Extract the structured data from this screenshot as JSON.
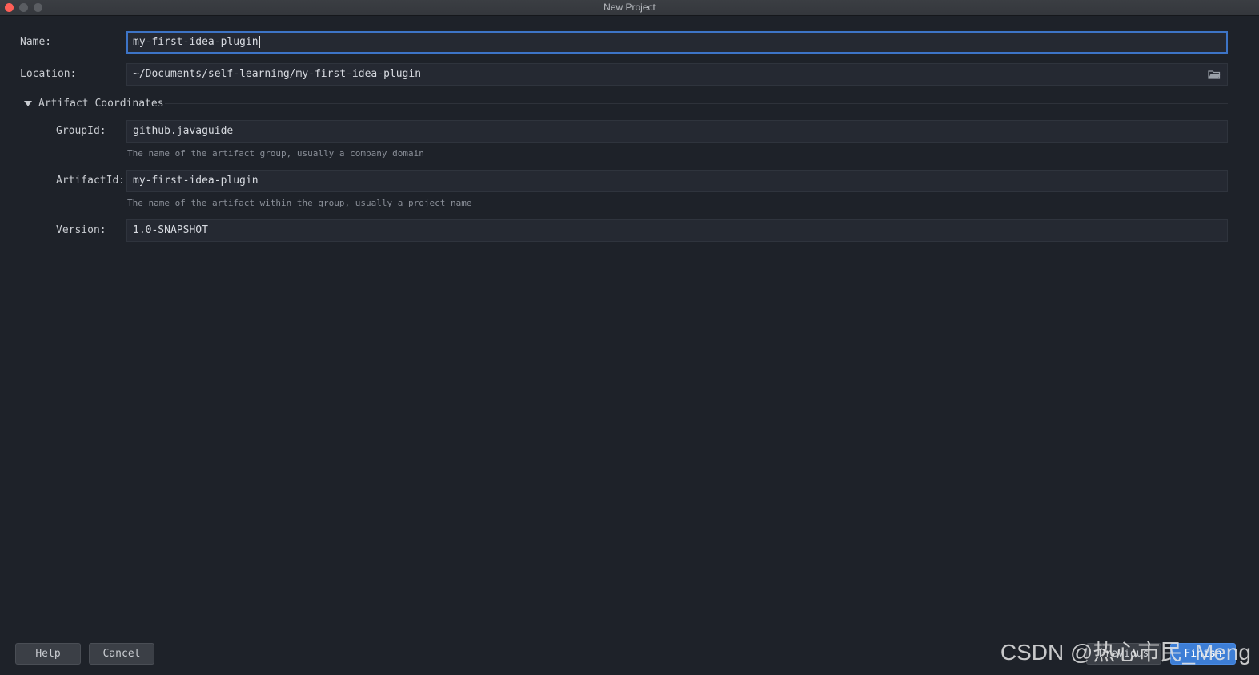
{
  "window": {
    "title": "New Project"
  },
  "form": {
    "name_label": "Name:",
    "name_value": "my-first-idea-plugin",
    "location_label": "Location:",
    "location_value": "~/Documents/self-learning/my-first-idea-plugin",
    "section_title": "Artifact Coordinates",
    "groupid_label": "GroupId:",
    "groupid_value": "github.javaguide",
    "groupid_hint": "The name of the artifact group, usually a company domain",
    "artifactid_label": "ArtifactId:",
    "artifactid_value": "my-first-idea-plugin",
    "artifactid_hint": "The name of the artifact within the group, usually a project name",
    "version_label": "Version:",
    "version_value": "1.0-SNAPSHOT"
  },
  "footer": {
    "help_label": "Help",
    "cancel_label": "Cancel",
    "previous_label": "Previous",
    "finish_label": "Finish"
  },
  "watermark": "CSDN @热心市民_Meng",
  "icons": {
    "folder": "folder-icon",
    "collapse": "triangle-down-icon"
  },
  "colors": {
    "background": "#1e2229",
    "field_bg": "#252932",
    "focus_border": "#3d74c6",
    "primary_button": "#3d7ed6",
    "close_button": "#ff5f57"
  }
}
